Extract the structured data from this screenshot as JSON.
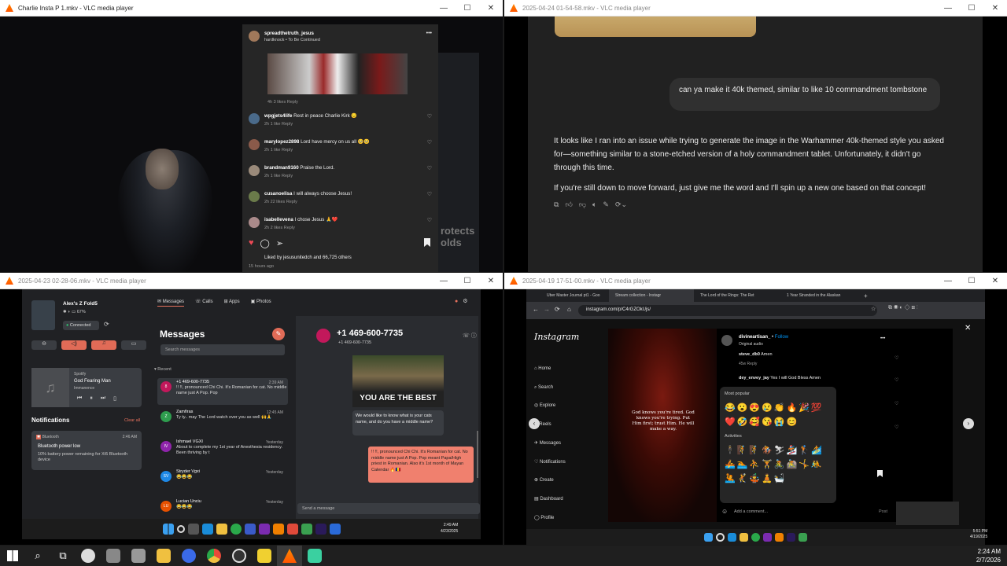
{
  "windows": {
    "tl": {
      "title": "Charlie Insta P 1.mkv - VLC media player"
    },
    "tr": {
      "title": "2025-04-24 01-54-58.mkv - VLC media player"
    },
    "bl": {
      "title": "2025-04-23 02-28-06.mkv - VLC media player"
    },
    "br": {
      "title": "2025-04-19 17-51-00.mkv - VLC media player"
    }
  },
  "controls": {
    "minimize": "—",
    "maximize": "☐",
    "close": "✕"
  },
  "ig_comments": {
    "header_user": "spreadthetruth_jesus",
    "header_sub": "hardknock • To Be Continued",
    "header_meta": "4h   3 likes   Reply",
    "items": [
      {
        "user": "wpgjets4life",
        "text": "Rest in peace Charlie Kirk 😔",
        "meta": "2h   1 like   Reply"
      },
      {
        "user": "marylopez2898",
        "text": "Lord have mercy on us all 🥺🥺",
        "meta": "2h   1 like   Reply"
      },
      {
        "user": "brandman9160",
        "text": "Praise the Lord.",
        "meta": "2h   1 like   Reply"
      },
      {
        "user": "cusanoelisa",
        "text": "I will always choose Jesus!",
        "meta": "2h   22 likes   Reply"
      },
      {
        "user": "isabellevena",
        "text": "I chose Jesus 🙏❤️",
        "meta": "2h   2 likes   Reply"
      }
    ],
    "liked_by": "Liked by jesusunitedch and 66,725 others",
    "time": "15 hours ago",
    "bg_text_1": "rotects",
    "bg_text_2": "olds"
  },
  "chat": {
    "user_msg": "can ya make it 40k themed, similar to like 10 commandment tombstone",
    "reply_1": "It looks like I ran into an issue while trying to generate the image in the Warhammer 40k-themed style you asked for—something similar to a stone-etched version of a holy commandment tablet. Unfortunately, it didn't go through this time.",
    "reply_2": "If you're still down to move forward, just give me the word and I'll spin up a new one based on that concept!"
  },
  "phonelink": {
    "device_name": "Alex's Z Fold5",
    "battery": "67%",
    "connected": "Connected",
    "tabs": [
      "Messages",
      "Calls",
      "Apps",
      "Photos"
    ],
    "media_app": "Spotify",
    "media_title": "God Fearing Man",
    "media_artist": "Immanence",
    "notifications_title": "Notifications",
    "clear_all": "Clear all",
    "notif_app": "Bluetooth",
    "notif_time": "2:46 AM",
    "notif_title": "Bluetooth power low",
    "notif_body": "10% battery power remaining for Xt5 Bluetooth device",
    "messages_title": "Messages",
    "search_placeholder": "Search messages",
    "recent": "Recent",
    "conversations": [
      {
        "initial": "8",
        "name": "+1 469-600-7735",
        "time": "2:39 AM",
        "preview": "!! !!, pronounced Chi Chi. It's Romanian for cat. No middle name just A Pop. Pop",
        "color": "#c2185b"
      },
      {
        "initial": "Z",
        "name": "Zamfiras",
        "time": "12:45 AM",
        "preview": "Ty ty.. may The Lord watch over you as well 🙌🙏",
        "color": "#2e9d4e"
      },
      {
        "initial": "IV",
        "name": "Ishmael VGXI",
        "time": "Yesterday",
        "preview": "About to complete my 1st year of Anesthesia residency. Been thriving by t",
        "color": "#8e24aa"
      },
      {
        "initial": "SV",
        "name": "Stryder Vgxi",
        "time": "Yesterday",
        "preview": "😂😂😂",
        "color": "#1e88e5"
      },
      {
        "initial": "LU",
        "name": "Lucian Unciu",
        "time": "Yesterday",
        "preview": "😂😂😂",
        "color": "#e65100"
      }
    ],
    "conv_phone": "+1 469-600-7735",
    "conv_sub": "+1 469-600-7735",
    "meme_text": "YOU ARE THE BEST",
    "in_msg": "We would like to know what is your cats name, and do you have a middle name?",
    "out_msg": "!! !!, pronounced Chi Chi. It's Romanian for cat. No middle name just A Pop. Pop meant Papa/High priest in Romanian. Also it's 1st month of Mayan Calendar 🔥🇷🇴",
    "send_placeholder": "Send a message",
    "clock_time": "2:49 AM",
    "clock_date": "4/23/2025"
  },
  "browser": {
    "tabs": [
      "Uber Master Journal pt1 - Goo",
      "Stream collection - Instagr",
      "The Lord of the Rings: The Ret",
      "1 Year Stranded in the Alaskan"
    ],
    "url": "instagram.com/p/C4rGZOkUjs/",
    "ig_nav": [
      "Home",
      "Search",
      "Explore",
      "Reels",
      "Messages",
      "Notifications",
      "Create",
      "Dashboard",
      "Profile"
    ],
    "post_user": "divineartisan_",
    "follow": "Follow",
    "post_audio": "Original audio",
    "c1_user": "steve_db0",
    "c1_text": "Amen",
    "c1_meta": "45w   Reply",
    "c2_user": "dey_envey_jay",
    "c2_text": "Yes I will God Bless Amen",
    "emoji_popular_label": "Most popular",
    "emoji_activities_label": "Activities",
    "emoji_popular": "😂😮😍😢👏🔥🎉💯❤️🤣🥰😘😭😊",
    "emoji_activities": "🕴🧗🧗🏇⛷🏂🏌🏄🚣🏊⛹🏋🚴🚵🤸🤼🤽🤾🤹🧘🛀",
    "quote": "God knows you're tired. God knows you're trying. Put Him first; trust Him. He will make a way.",
    "add_comment": "Add a comment...",
    "post": "Post",
    "clock_time": "5:51 PM",
    "clock_date": "4/19/2025"
  },
  "taskbar": {
    "time": "2:24 AM",
    "date": "2/7/2026"
  }
}
